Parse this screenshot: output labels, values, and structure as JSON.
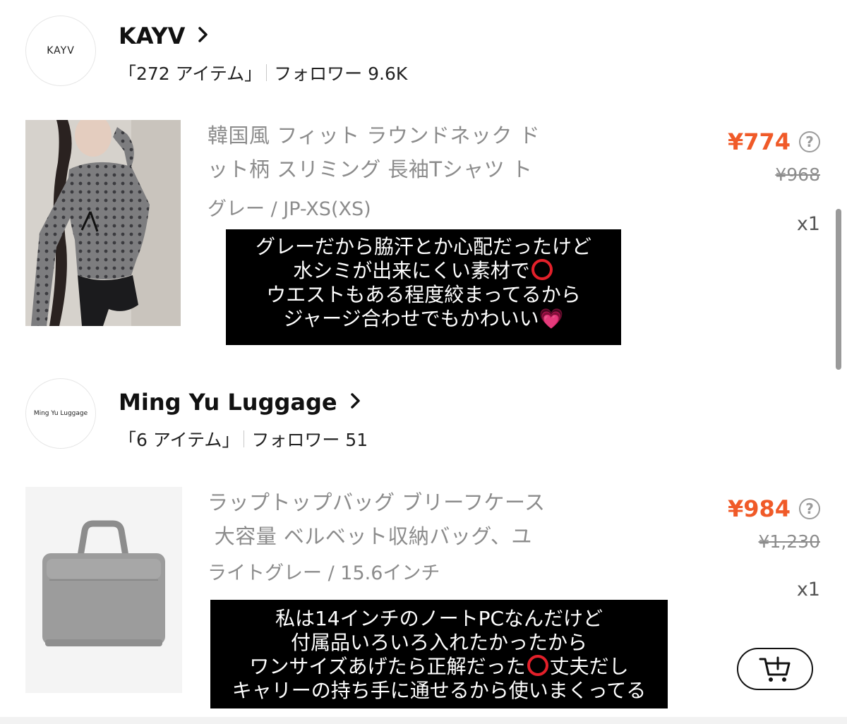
{
  "stores": [
    {
      "logo_text": "KAYV",
      "name": "KAYV",
      "item_count": "「272 アイテム」",
      "followers": "フォロワー 9.6K",
      "product": {
        "title_lines": [
          "韓国風 フィット ラウンドネック ド",
          "ット柄 スリミング 長袖Tシャツ ト"
        ],
        "variant": "グレー / JP-XS(XS)",
        "price": "¥774",
        "original_price": "¥968",
        "quantity": "x1"
      },
      "caption": {
        "line1": "グレーだから脇汗とか心配だったけど",
        "line2": "水シミが出来にくい素材で",
        "line3": "ウエストもある程度絞まってるから",
        "line4": "ジャージ合わせでもかわいい"
      }
    },
    {
      "logo_text": "Ming Yu Luggage",
      "name": "Ming Yu Luggage",
      "item_count": "「6 アイテム」",
      "followers": "フォロワー 51",
      "product": {
        "title_lines": [
          "ラップトップバッグ ブリーフケース",
          " 大容量 ベルベット収納バッグ、ユ"
        ],
        "variant": "ライトグレー / 15.6インチ",
        "price": "¥984",
        "original_price": "¥1,230",
        "quantity": "x1"
      },
      "caption": {
        "line1": "私は14インチのノートPCなんだけど",
        "line2": "付属品いろいろ入れたかったから",
        "line3a": "ワンサイズあげたら正解だった",
        "line3b": "丈夫だし",
        "line4": "キャリーの持ち手に通せるから使いまくってる"
      }
    }
  ],
  "icons": {
    "chevron": "chevron-right-icon",
    "help": "question-circle-icon",
    "cart": "add-to-cart-icon",
    "heart_emoji": "💗",
    "circle_emoji": "red-circle-emoji"
  },
  "colors": {
    "price": "#f05a28",
    "muted": "#8c8c8c",
    "caption_bg": "#000000"
  },
  "help_glyph": "?"
}
